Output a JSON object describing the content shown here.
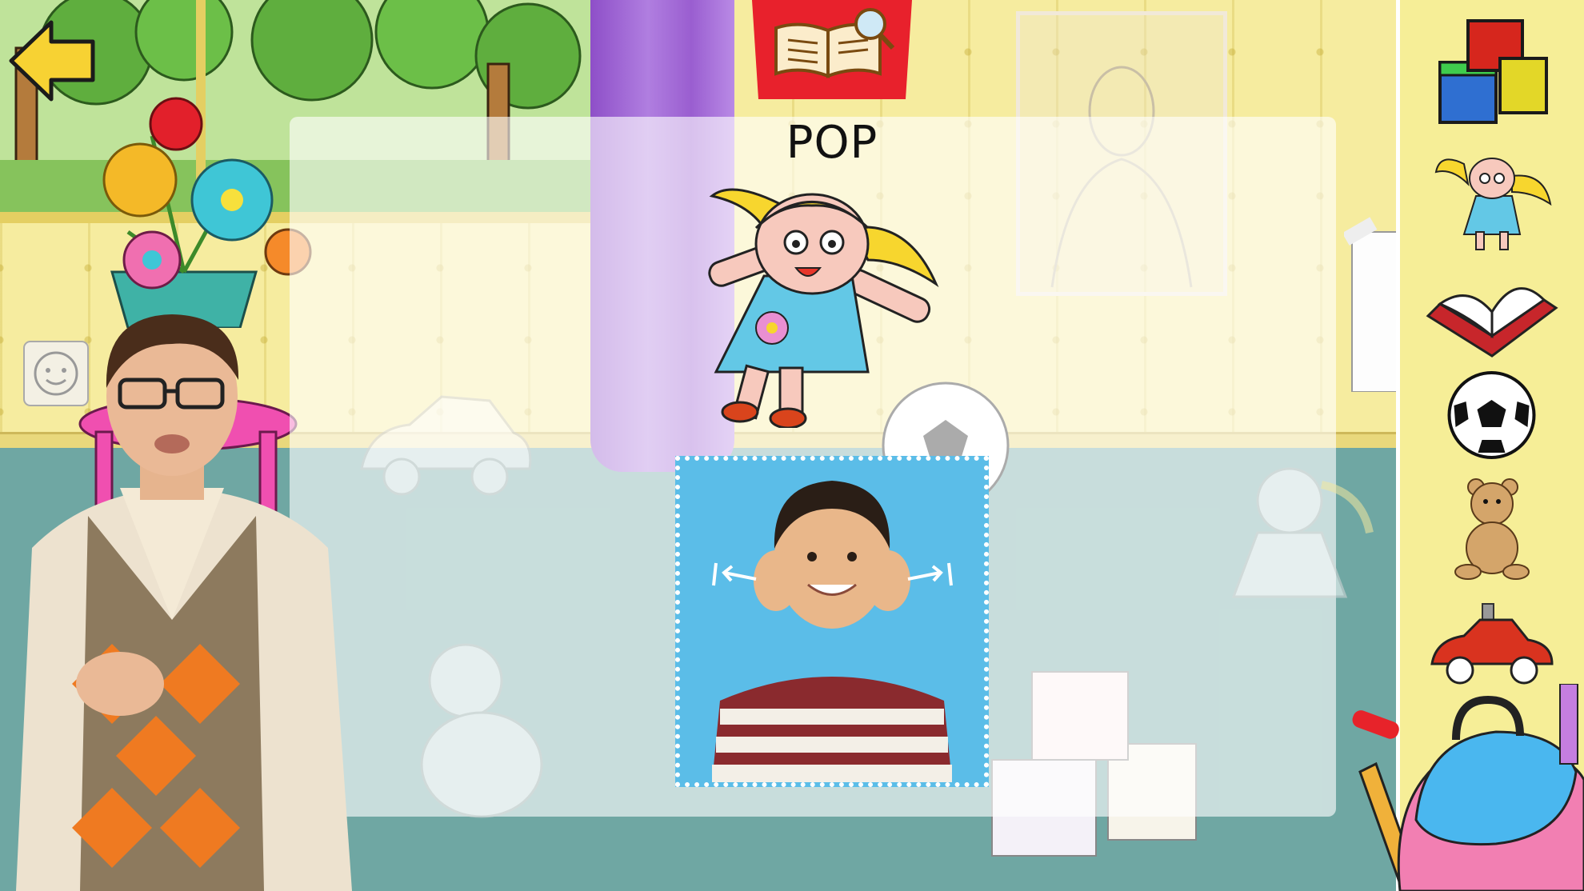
{
  "word": {
    "title": "POP"
  },
  "sidebar": {
    "items": [
      {
        "name": "blocks"
      },
      {
        "name": "doll"
      },
      {
        "name": "book"
      },
      {
        "name": "ball"
      },
      {
        "name": "teddy-bear"
      },
      {
        "name": "toy-car"
      }
    ]
  },
  "icons": {
    "back": "arrow-left-icon",
    "dictionary": "book-search-icon"
  },
  "colors": {
    "sidebar_bg": "#f6ee97",
    "sign_card_bg": "#5bbde8",
    "dictionary_tab": "#e8212c",
    "back_arrow": "#f7d233"
  }
}
